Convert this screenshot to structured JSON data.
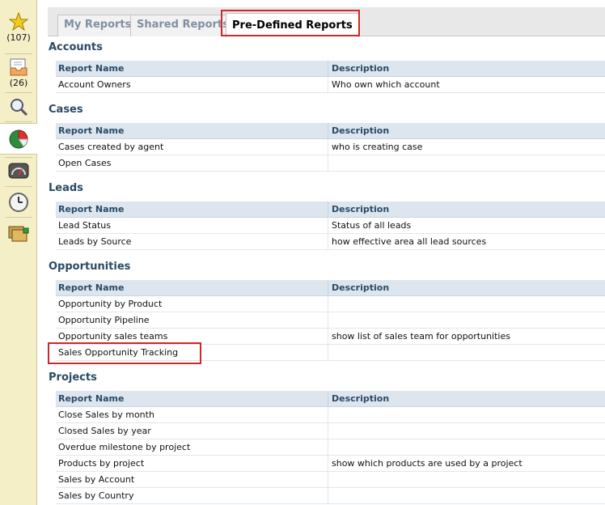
{
  "sidebar": {
    "items": [
      {
        "icon": "star-icon",
        "count": "(107)"
      },
      {
        "icon": "inbox-icon",
        "count": "(26)"
      },
      {
        "icon": "magnifier-icon"
      },
      {
        "icon": "pie-chart-icon"
      },
      {
        "icon": "dashboard-gauge-icon"
      },
      {
        "icon": "clock-icon"
      },
      {
        "icon": "stacked-papers-icon"
      }
    ]
  },
  "tabs": [
    {
      "label": "My Reports"
    },
    {
      "label": "Shared Reports"
    },
    {
      "label": "Pre-Defined Reports"
    }
  ],
  "active_tab": "Pre-Defined Reports",
  "columns": {
    "name": "Report Name",
    "description": "Description"
  },
  "sections": [
    {
      "title": "Accounts",
      "rows": [
        {
          "name": "Account Owners",
          "description": "Who own which account"
        }
      ]
    },
    {
      "title": "Cases",
      "rows": [
        {
          "name": "Cases created by agent",
          "description": "who is creating case"
        },
        {
          "name": "Open Cases",
          "description": ""
        }
      ]
    },
    {
      "title": "Leads",
      "rows": [
        {
          "name": "Lead Status",
          "description": "Status of all leads"
        },
        {
          "name": "Leads by Source",
          "description": "how effective area all lead sources"
        }
      ]
    },
    {
      "title": "Opportunities",
      "rows": [
        {
          "name": "Opportunity by Product",
          "description": ""
        },
        {
          "name": "Opportunity Pipeline",
          "description": ""
        },
        {
          "name": "Opportunity sales teams",
          "description": "show list of sales team for opportunities"
        },
        {
          "name": "Sales Opportunity Tracking",
          "description": ""
        }
      ]
    },
    {
      "title": "Projects",
      "rows": [
        {
          "name": "Close Sales by month",
          "description": ""
        },
        {
          "name": "Closed Sales by year",
          "description": ""
        },
        {
          "name": "Overdue milestone by project",
          "description": ""
        },
        {
          "name": "Products by project",
          "description": "show which products are used by a project"
        },
        {
          "name": "Sales by Account",
          "description": ""
        },
        {
          "name": "Sales by Country",
          "description": ""
        }
      ]
    }
  ],
  "colors": {
    "highlight": "#cc2a2a",
    "section_title": "#2a4a66",
    "header_bg": "#dde6ef",
    "rail_bg": "#f5efc8"
  }
}
